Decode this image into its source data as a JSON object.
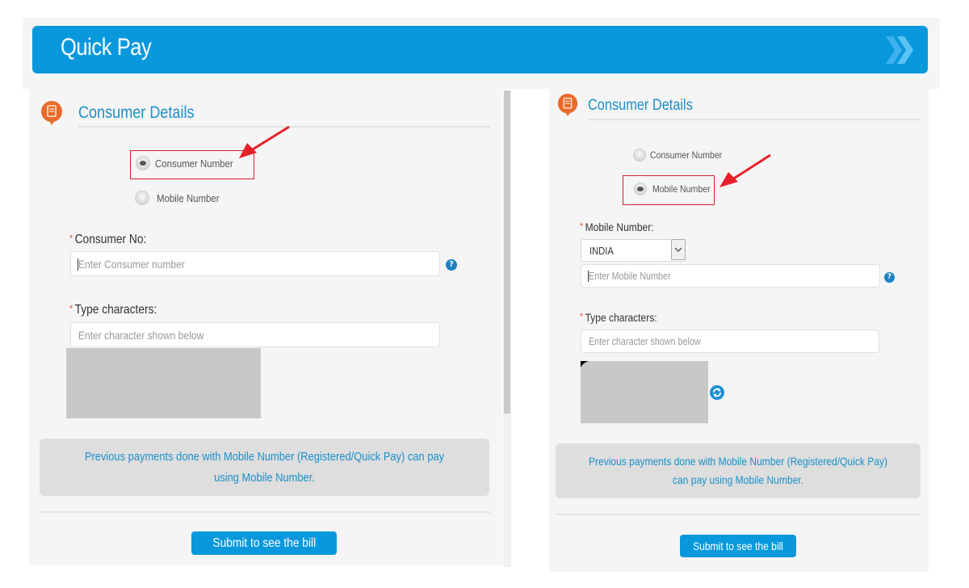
{
  "header": {
    "title": "Quick Pay",
    "chevron_icon": "double-chevron-right",
    "brand_color": "#0998dc"
  },
  "left_form": {
    "section_title": "Consumer Details",
    "section_icon": "receipt-speech-bubble",
    "radio_options": [
      {
        "label": "Consumer Number",
        "checked": true
      },
      {
        "label": "Mobile Number",
        "checked": false
      }
    ],
    "consumer_no": {
      "label": "Consumer No:",
      "placeholder": "Enter Consumer number",
      "value": ""
    },
    "captcha": {
      "label": "Type characters:",
      "placeholder": "Enter character shown below",
      "value": ""
    },
    "info_text": "Previous payments done with Mobile Number (Registered/Quick Pay) can pay using Mobile Number.",
    "submit_label": "Submit to see the bill"
  },
  "right_form": {
    "section_title": "Consumer Details",
    "section_icon": "receipt-speech-bubble",
    "radio_options": [
      {
        "label": "Consumer Number",
        "checked": false
      },
      {
        "label": "Mobile Number",
        "checked": true
      }
    ],
    "mobile_number": {
      "label": "Mobile Number:",
      "country_selected": "INDIA",
      "placeholder": "Enter Mobile Number",
      "value": ""
    },
    "captcha": {
      "label": "Type characters:",
      "placeholder": "Enter character shown below",
      "value": ""
    },
    "info_text": "Previous payments done with Mobile Number (Registered/Quick Pay) can pay using Mobile Number.",
    "submit_label": "Submit to see the bill"
  },
  "required_marker": "*",
  "help_glyph": "?",
  "annotation_color": "#d0202a"
}
